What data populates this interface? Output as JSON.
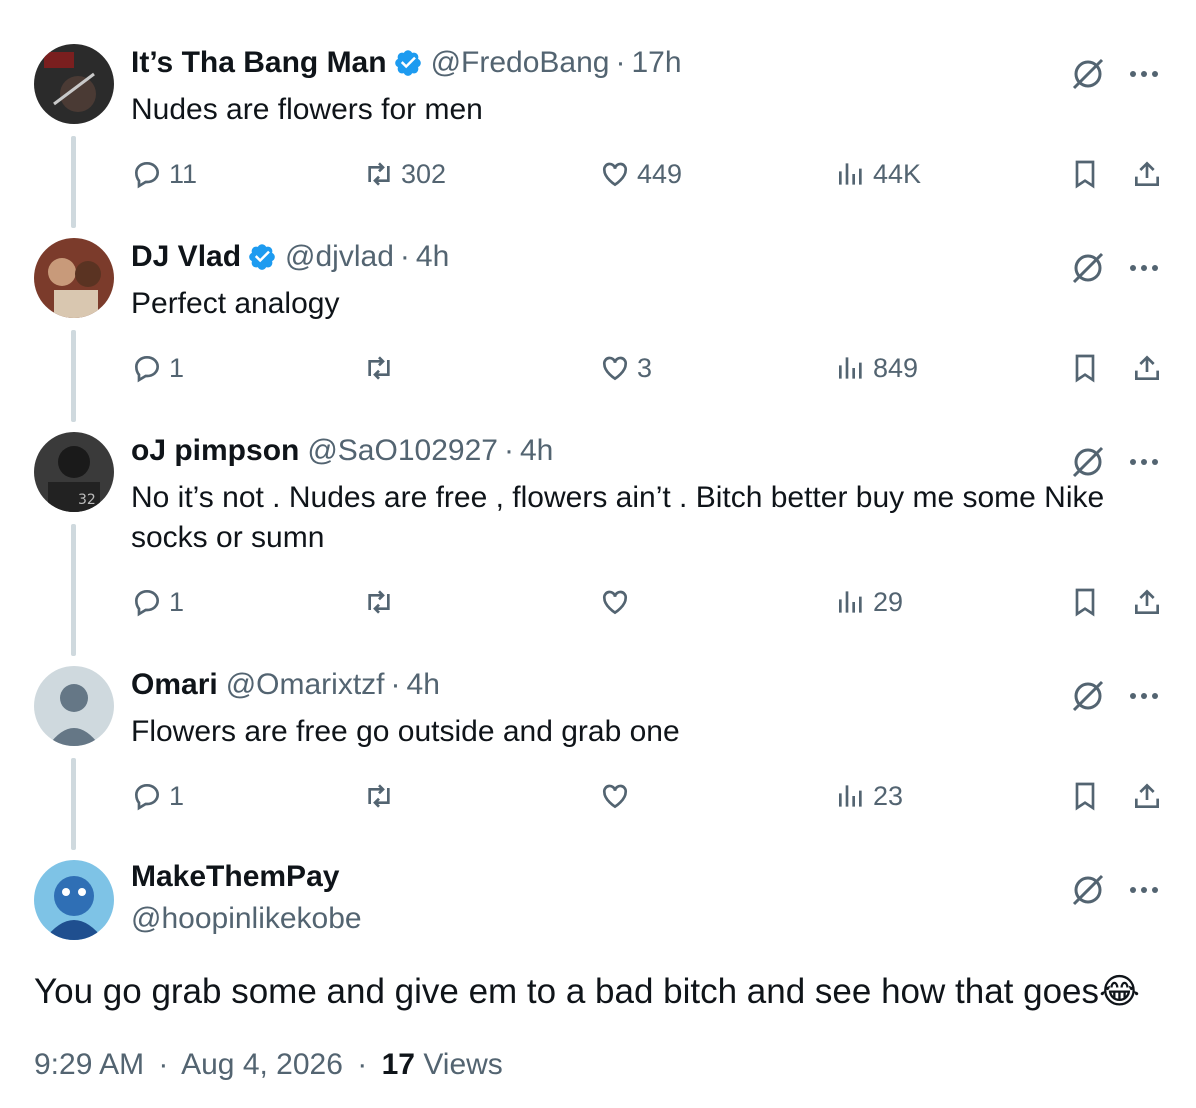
{
  "tweets": [
    {
      "name": "It’s Tha Bang Man",
      "verified": true,
      "handle": "@FredoBang",
      "time": "17h",
      "text": "Nudes are flowers for men",
      "replies": "11",
      "retweets": "302",
      "likes": "449",
      "views": "44K",
      "avatar_color": "#2a2a2a"
    },
    {
      "name": "DJ Vlad",
      "verified": true,
      "handle": "@djvlad",
      "time": "4h",
      "text": "Perfect analogy",
      "replies": "1",
      "retweets": "",
      "likes": "3",
      "views": "849",
      "avatar_color": "#8a4a3a"
    },
    {
      "name": "oJ pimpson",
      "verified": false,
      "handle": "@SaO102927",
      "time": "4h",
      "text": "No it’s not . Nudes are free , flowers ain’t . Bitch better buy me some Nike socks or sumn",
      "replies": "1",
      "retweets": "",
      "likes": "",
      "views": "29",
      "avatar_color": "#1c1c1c"
    },
    {
      "name": "Omari",
      "verified": false,
      "handle": "@Omarixtzf",
      "time": "4h",
      "text": "Flowers are free go outside and grab one",
      "replies": "1",
      "retweets": "",
      "likes": "",
      "views": "23",
      "avatar_color": "#cfd9de"
    }
  ],
  "main": {
    "name": "MakeThemPay",
    "handle": "@hoopinlikekobe",
    "text": "You go grab some and give em to a bad bitch and see how that goes😂",
    "time": "9:29 AM",
    "date": "Aug 4, 2026",
    "views_count": "17",
    "views_label": "Views"
  },
  "separator": "·",
  "colors": {
    "text": "#0f1419",
    "secondary": "#536471",
    "verified": "#1d9bf0",
    "thread_line": "#cfd9de"
  },
  "icons": [
    "reply-icon",
    "retweet-icon",
    "like-icon",
    "views-icon",
    "bookmark-icon",
    "share-icon",
    "grok-icon",
    "more-icon",
    "verified-badge-icon"
  ]
}
